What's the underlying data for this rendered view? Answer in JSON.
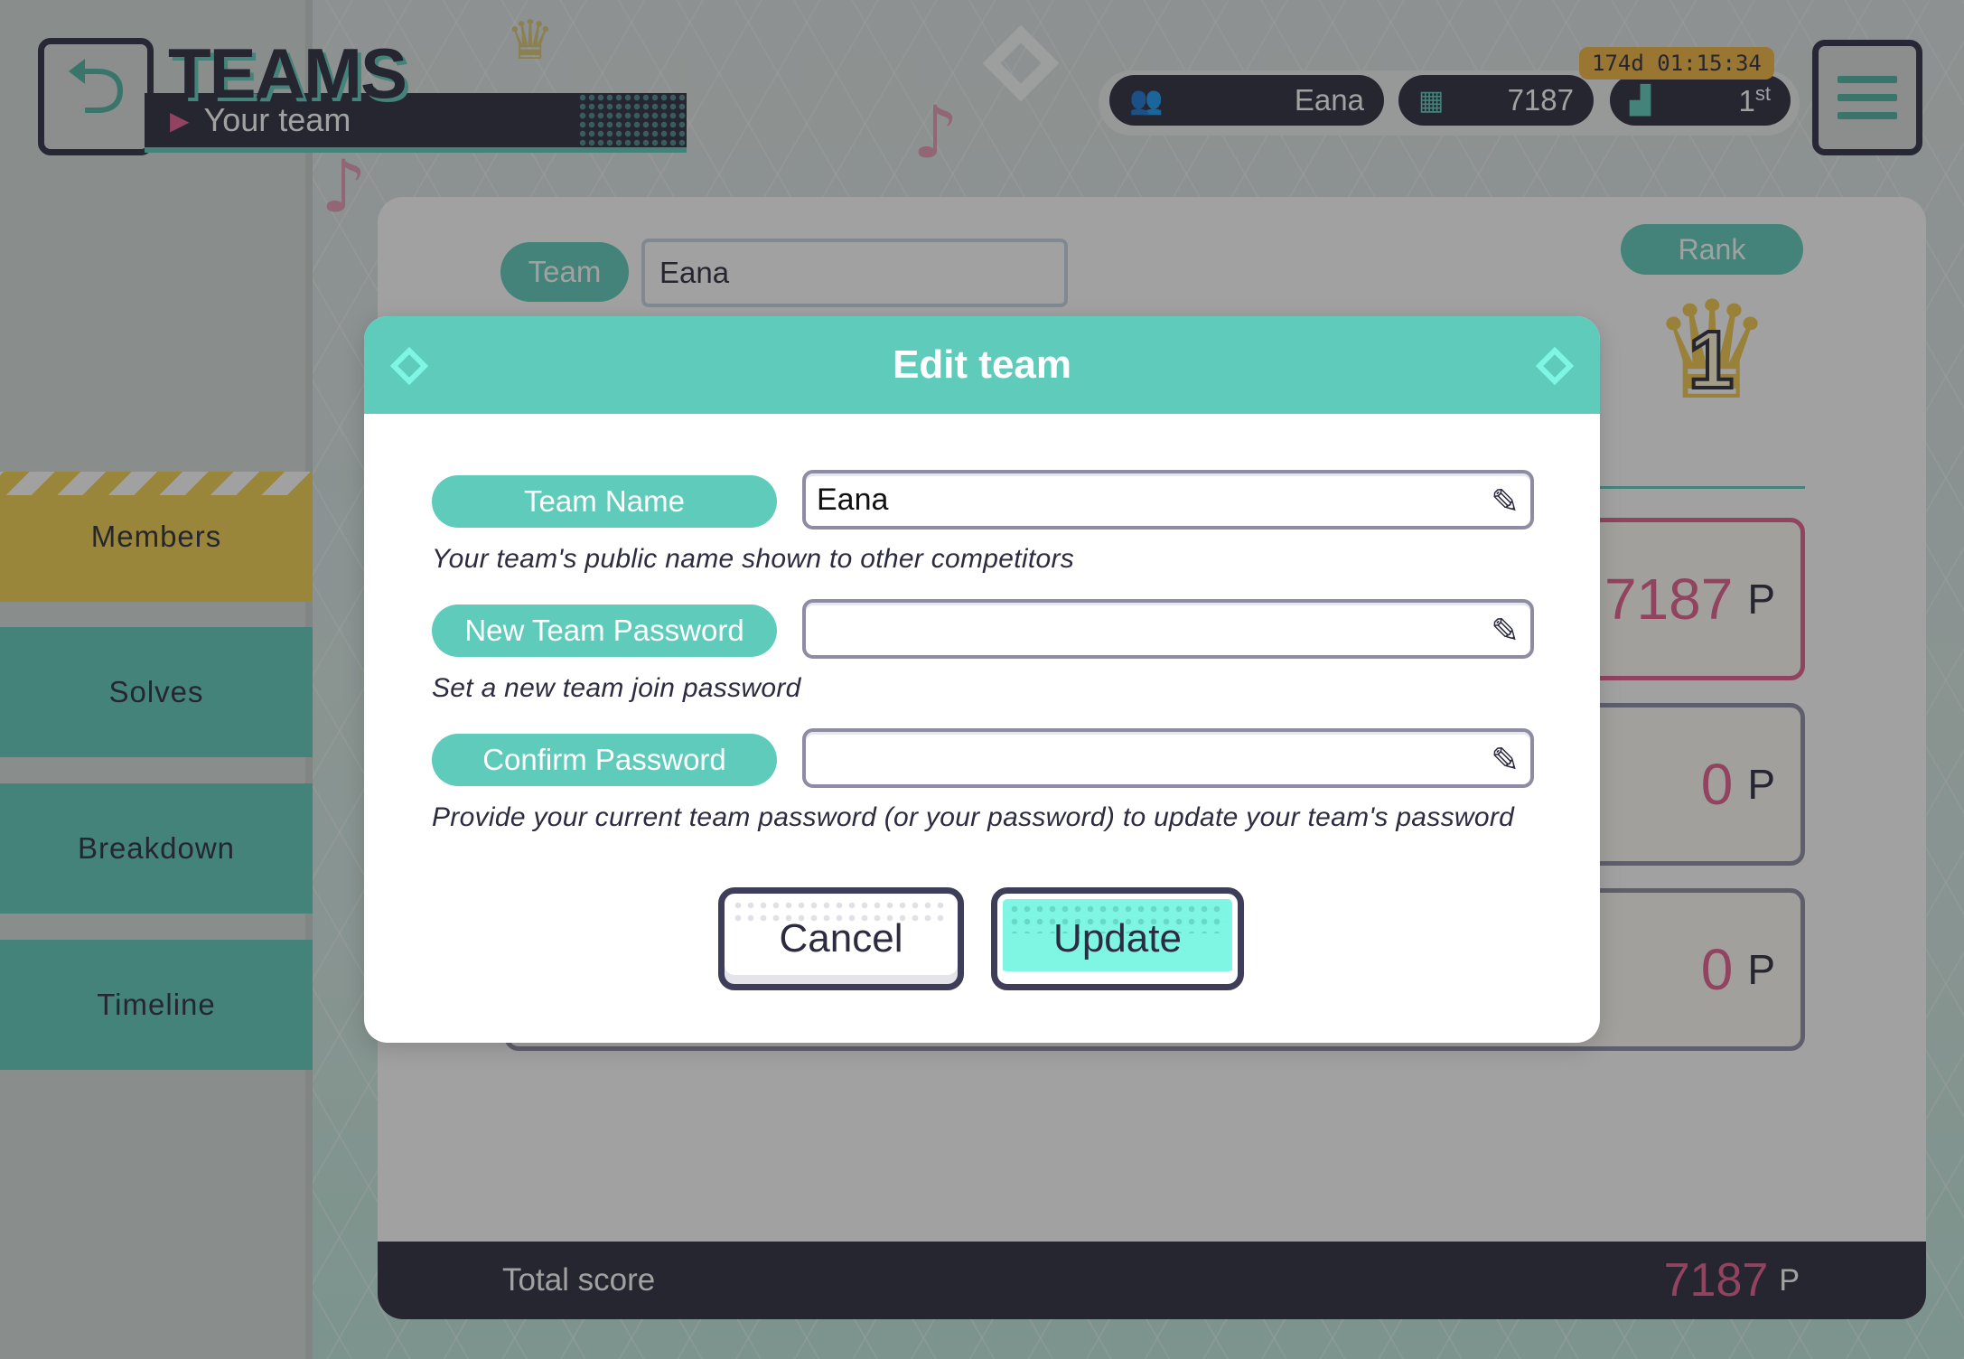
{
  "header": {
    "title": "TEAMS",
    "subtitle": "Your team",
    "timer": "174d 01:15:34"
  },
  "status": {
    "user": "Eana",
    "score": "7187",
    "rank_number": "1",
    "rank_suffix": "st"
  },
  "sidebar": {
    "items": [
      {
        "label": "Members"
      },
      {
        "label": "Solves"
      },
      {
        "label": "Breakdown"
      },
      {
        "label": "Timeline"
      }
    ]
  },
  "card": {
    "team_label": "Team",
    "team_value": "Eana",
    "rank_label": "Rank",
    "rank_value": "1",
    "scores": [
      {
        "value": "7187",
        "unit": "P"
      },
      {
        "value": "0",
        "unit": "P"
      },
      {
        "value": "0",
        "unit": "P"
      }
    ],
    "total_label": "Total score",
    "total_value": "7187",
    "total_unit": "P"
  },
  "modal": {
    "title": "Edit team",
    "fields": [
      {
        "label": "Team Name",
        "value": "Eana",
        "help": "Your team's public name shown to other competitors"
      },
      {
        "label": "New Team Password",
        "value": "",
        "help": "Set a new team join password"
      },
      {
        "label": "Confirm Password",
        "value": "",
        "help": "Provide your current team password (or your password) to update your team's password"
      }
    ],
    "cancel_label": "Cancel",
    "update_label": "Update"
  },
  "colors": {
    "accent": "#5ecbbb",
    "dark": "#2c2b3f",
    "highlight": "#7ff5e3",
    "score": "#e35d8f",
    "members": "#f2d050",
    "timer": "#f2b53e"
  },
  "icons": {
    "back": "back-arrow-icon",
    "menu": "hamburger-menu-icon",
    "user": "users-icon",
    "score": "scoreboard-icon",
    "rank": "podium-icon",
    "edit": "pencil-icon",
    "crown": "crown-icon"
  }
}
